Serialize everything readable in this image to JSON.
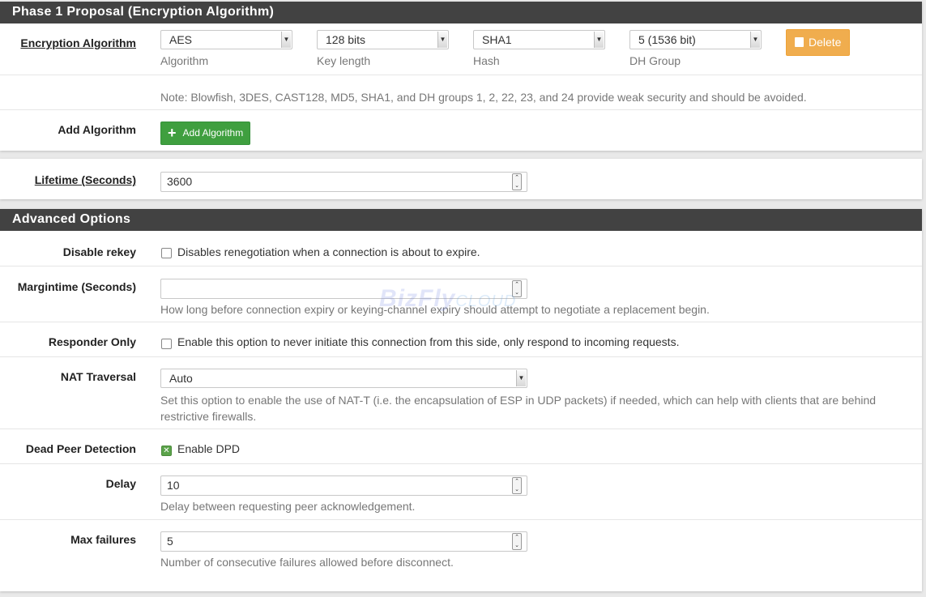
{
  "phase1": {
    "heading": "Phase 1 Proposal (Encryption Algorithm)",
    "encryption_label": "Encryption Algorithm",
    "algorithm": {
      "value": "AES",
      "caption": "Algorithm"
    },
    "key_length": {
      "value": "128 bits",
      "caption": "Key length"
    },
    "hash": {
      "value": "SHA1",
      "caption": "Hash"
    },
    "dh_group": {
      "value": "5 (1536 bit)",
      "caption": "DH Group"
    },
    "delete_label": "Delete",
    "note": "Note: Blowfish, 3DES, CAST128, MD5, SHA1, and DH groups 1, 2, 22, 23, and 24 provide weak security and should be avoided.",
    "add_label": "Add Algorithm",
    "add_button": "Add Algorithm"
  },
  "lifetime": {
    "label": "Lifetime (Seconds)",
    "value": "3600"
  },
  "advanced": {
    "heading": "Advanced Options",
    "disable_rekey": {
      "label": "Disable rekey",
      "text": "Disables renegotiation when a connection is about to expire."
    },
    "margintime": {
      "label": "Margintime (Seconds)",
      "value": "",
      "help": "How long before connection expiry or keying-channel expiry should attempt to negotiate a replacement begin."
    },
    "responder_only": {
      "label": "Responder Only",
      "text": "Enable this option to never initiate this connection from this side, only respond to incoming requests."
    },
    "nat_traversal": {
      "label": "NAT Traversal",
      "value": "Auto",
      "help": "Set this option to enable the use of NAT-T (i.e. the encapsulation of ESP in UDP packets) if needed, which can help with clients that are behind restrictive firewalls."
    },
    "dpd": {
      "label": "Dead Peer Detection",
      "text": "Enable DPD"
    },
    "delay": {
      "label": "Delay",
      "value": "10",
      "help": "Delay between requesting peer acknowledgement."
    },
    "max_failures": {
      "label": "Max failures",
      "value": "5",
      "help": "Number of consecutive failures allowed before disconnect."
    }
  },
  "watermark": {
    "brand": "BizFly",
    "sub": "CLOUD"
  },
  "colors": {
    "header_bg": "#424242",
    "green": "#3f9f3f",
    "orange": "#f0ad4e"
  }
}
